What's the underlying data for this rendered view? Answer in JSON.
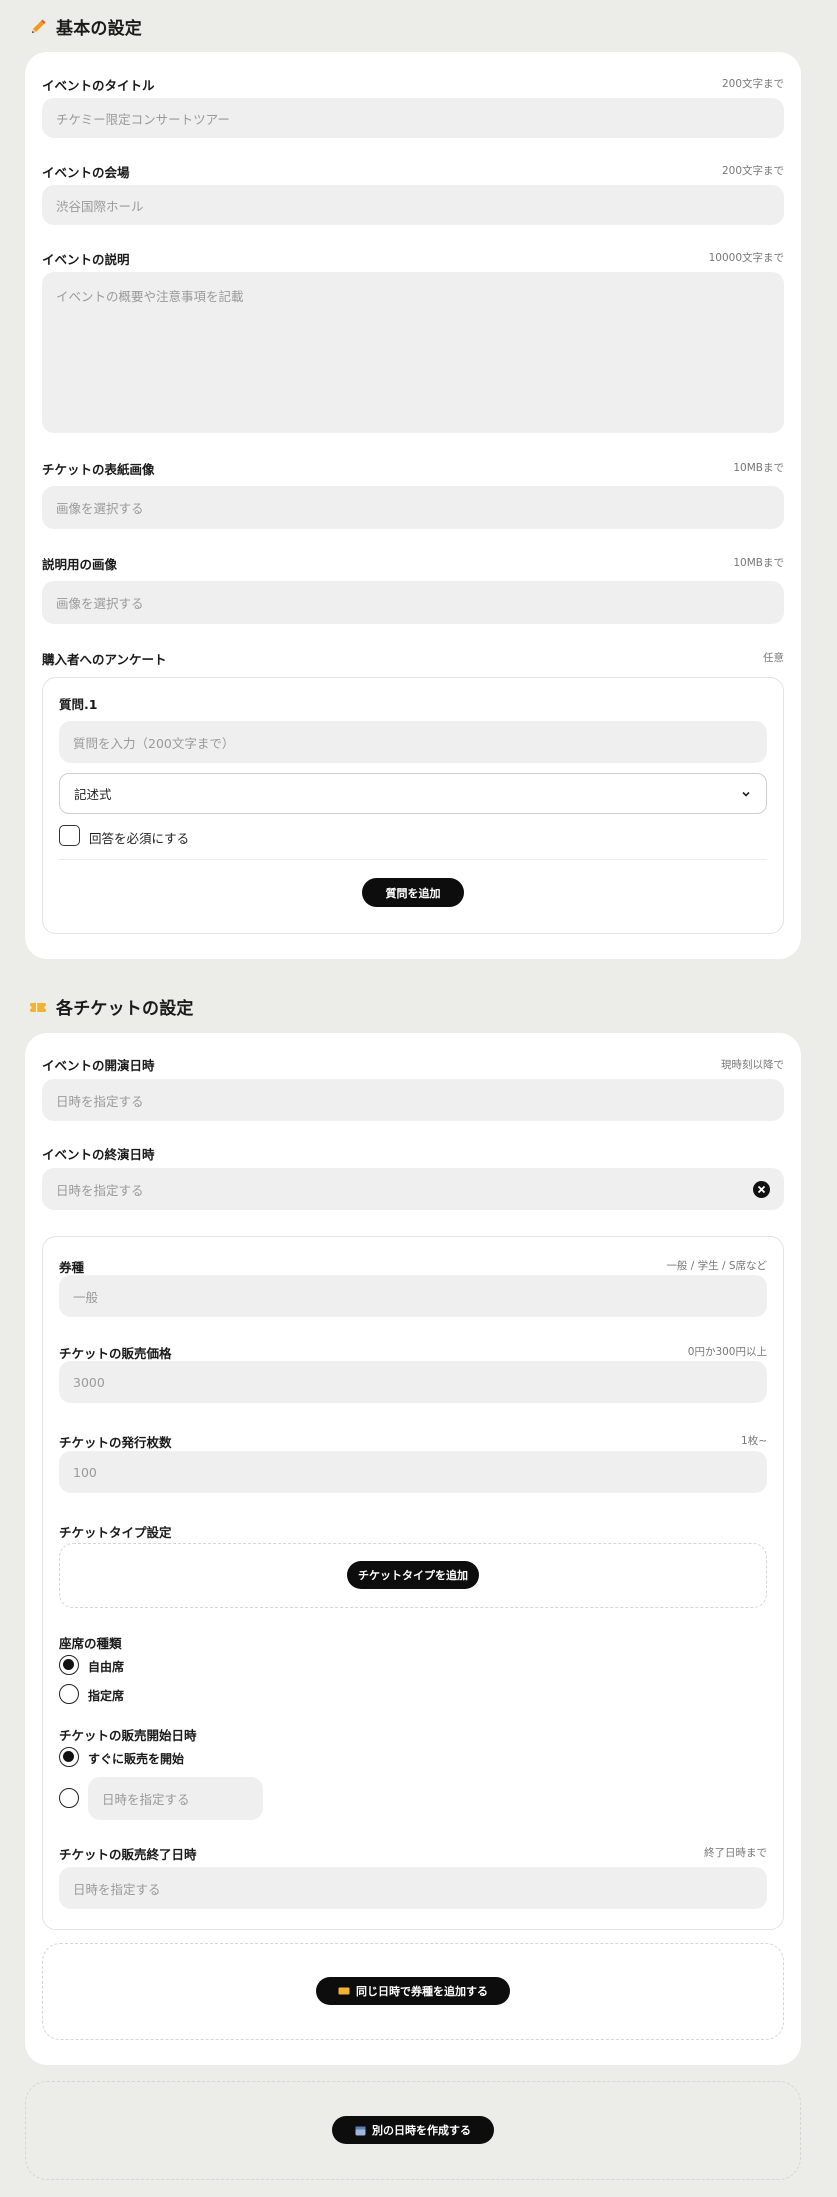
{
  "basic": {
    "title": "基本の設定",
    "event_title": {
      "label": "イベントのタイトル",
      "hint": "200文字まで",
      "placeholder": "チケミー限定コンサートツアー"
    },
    "venue": {
      "label": "イベントの会場",
      "hint": "200文字まで",
      "placeholder": "渋谷国際ホール"
    },
    "description": {
      "label": "イベントの説明",
      "hint": "10000文字まで",
      "placeholder": "イベントの概要や注意事項を記載"
    },
    "cover_image": {
      "label": "チケットの表紙画像",
      "hint": "10MBまで",
      "placeholder": "画像を選択する"
    },
    "desc_image": {
      "label": "説明用の画像",
      "hint": "10MBまで",
      "placeholder": "画像を選択する"
    },
    "survey": {
      "label": "購入者へのアンケート",
      "hint": "任意",
      "question_label": "質問.1",
      "question_placeholder": "質問を入力（200文字まで）",
      "type_selected": "記述式",
      "required_label": "回答を必須にする",
      "add_button": "質問を追加"
    }
  },
  "tickets": {
    "title": "各チケットの設定",
    "start": {
      "label": "イベントの開演日時",
      "hint": "現時刻以降で",
      "placeholder": "日時を指定する"
    },
    "end": {
      "label": "イベントの終演日時",
      "placeholder": "日時を指定する"
    },
    "type_box": {
      "kind": {
        "label": "券種",
        "hint": "一般 / 学生 / S席など",
        "placeholder": "一般"
      },
      "price": {
        "label": "チケットの販売価格",
        "hint": "0円か300円以上",
        "placeholder": "3000"
      },
      "count": {
        "label": "チケットの発行枚数",
        "hint": "1枚~",
        "placeholder": "100"
      },
      "ticket_type": {
        "label": "チケットタイプ設定",
        "add_button": "チケットタイプを追加"
      },
      "seat": {
        "label": "座席の種類",
        "options": [
          "自由席",
          "指定席"
        ],
        "selected": "自由席"
      },
      "sale_start": {
        "label": "チケットの販売開始日時",
        "option_now": "すぐに販売を開始",
        "option_specify_placeholder": "日時を指定する"
      },
      "sale_end": {
        "label": "チケットの販売終了日時",
        "hint": "終了日時まで",
        "placeholder": "日時を指定する"
      }
    },
    "add_same_date_button": "同じ日時で券種を追加する"
  },
  "add_other_date_button": "別の日時を作成する",
  "colors": {
    "accent": "#f0a020",
    "background": "#ecece8",
    "card": "#ffffff",
    "field": "#efefef",
    "button": "#0d0d0d"
  }
}
